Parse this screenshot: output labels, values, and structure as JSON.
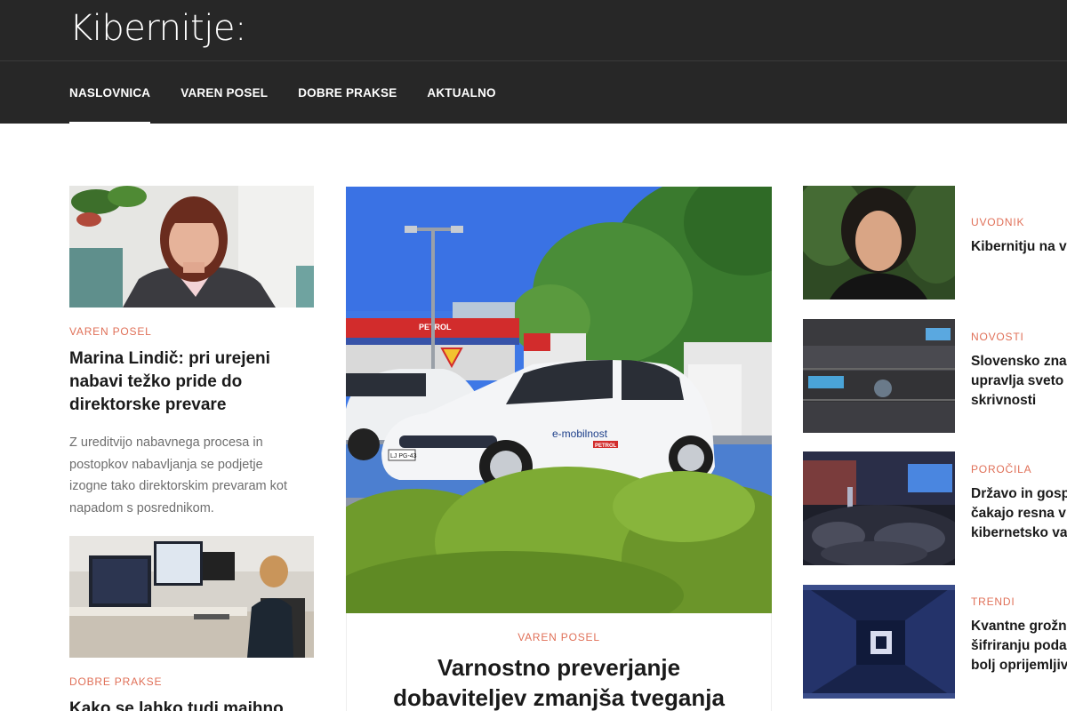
{
  "header": {
    "logo": "Kibernitje:",
    "nav": [
      {
        "label": "NASLOVNICA",
        "active": true
      },
      {
        "label": "VAREN POSEL",
        "active": false
      },
      {
        "label": "DOBRE PRAKSE",
        "active": false
      },
      {
        "label": "AKTUALNO",
        "active": false
      }
    ]
  },
  "left": {
    "article1": {
      "category": "VAREN POSEL",
      "title_line1": "Marina Lindič: pri urejeni",
      "title_line2": "nabavi težko pride do",
      "title_line3": "direktorske prevare",
      "excerpt_line1": "Z ureditvijo nabavnega procesa in",
      "excerpt_line2": "postopkov nabavljanja se podjetje",
      "excerpt_line3": "izogne tako direktorskim prevaram kot",
      "excerpt_line4": "napadom s posrednikom."
    },
    "article2": {
      "category": "DOBRE PRAKSE",
      "title_line1": "Kako se lahko tudi majhno"
    }
  },
  "center": {
    "category": "VAREN POSEL",
    "title_line1": "Varnostno preverjanje",
    "title_line2": "dobaviteljev zmanjša tveganja",
    "image_signs": {
      "station": "PETROL",
      "car_text": "e-mobilnost",
      "car_brand": "PETROL",
      "plate": "LJ PG-43"
    }
  },
  "right": [
    {
      "category": "UVODNIK",
      "title_lines": [
        "Kibernitju na v"
      ]
    },
    {
      "category": "NOVOSTI",
      "title_lines": [
        "Slovensko zna",
        "upravlja sveto",
        "skrivnosti"
      ]
    },
    {
      "category": "POROČILA",
      "title_lines": [
        "Državo in gosp",
        "čakajo resna v",
        "kibernetsko va"
      ]
    },
    {
      "category": "TRENDI",
      "title_lines": [
        "Kvantne grožn",
        "šifriranju poda",
        "bolj oprijemljiv"
      ]
    }
  ],
  "colors": {
    "header_bg": "#272727",
    "category_accent": "#e07058"
  }
}
